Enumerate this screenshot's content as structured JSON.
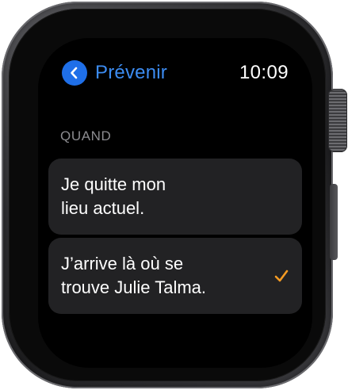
{
  "nav": {
    "back_label": "Prévenir",
    "back_icon": "chevron-left-icon"
  },
  "status": {
    "time": "10:09"
  },
  "section": {
    "header": "QUAND"
  },
  "options": [
    {
      "label_line1": "Je quitte mon",
      "label_line2": "lieu actuel.",
      "selected": false
    },
    {
      "label_line1": "J’arrive là où se",
      "label_line2": "trouve Julie Talma.",
      "selected": true
    }
  ],
  "colors": {
    "accent_blue": "#1f6fe8",
    "check_orange": "#f59b23",
    "row_background": "#222224",
    "header_gray": "#8c8c90"
  }
}
